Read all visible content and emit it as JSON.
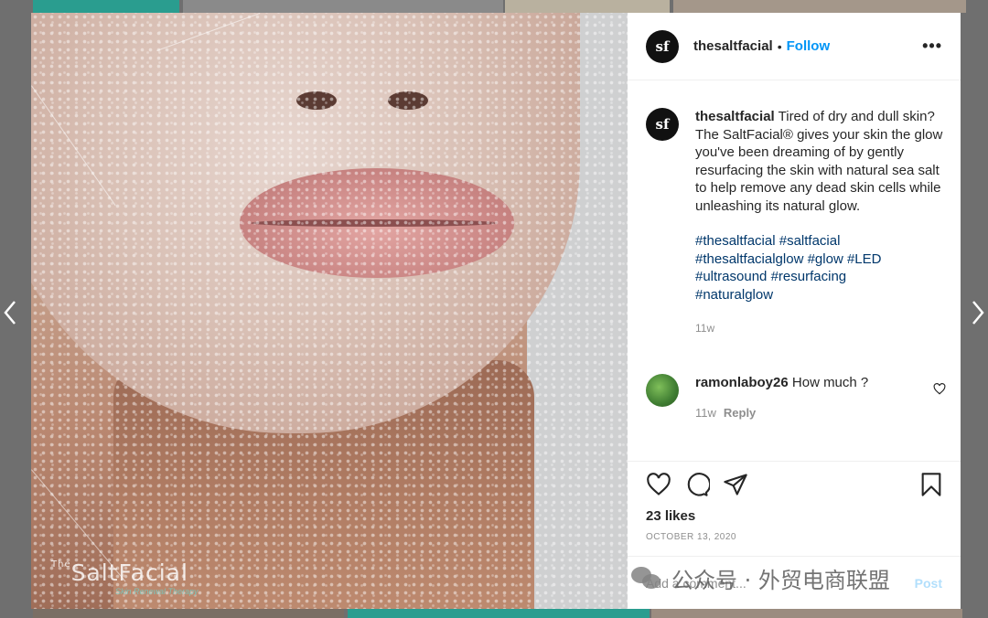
{
  "post": {
    "username": "thesaltfacial",
    "avatar_initials": "sf",
    "header_separator": "•",
    "follow_label": "Follow",
    "more_label": "•••",
    "caption_text": "Tired of dry and dull skin? The SaltFacial® gives your skin the glow you've been dreaming of by gently resurfacing the skin with natural sea salt to help remove any dead skin cells while unleashing its natural glow.",
    "hashtags": [
      "#thesaltfacial",
      "#saltfacial",
      "#thesaltfacialglow",
      "#glow",
      "#LED",
      "#ultrasound",
      "#resurfacing",
      "#naturalglow"
    ],
    "caption_age": "11w",
    "likes": "23 likes",
    "date": "OCTOBER 13, 2020"
  },
  "comment": {
    "username": "ramonlaboy26",
    "text": "How much ?",
    "age": "11w",
    "reply_label": "Reply"
  },
  "add_comment": {
    "placeholder": "Add a comment...",
    "post_label": "Post"
  },
  "image": {
    "brand_logo": "SaltFacial",
    "brand_logo_prefix": "The",
    "brand_tagline": "Skin Renewal Therapy"
  },
  "watermark": {
    "text": "公众号 · 外贸电商联盟"
  },
  "colors": {
    "link_blue": "#0095f6",
    "hashtag_blue": "#00376b",
    "muted_gray": "#8e8e8e"
  },
  "icons": [
    "chevron-left-icon",
    "chevron-right-icon",
    "more-icon",
    "heart-icon",
    "comment-icon",
    "share-icon",
    "bookmark-icon",
    "wechat-icon"
  ]
}
